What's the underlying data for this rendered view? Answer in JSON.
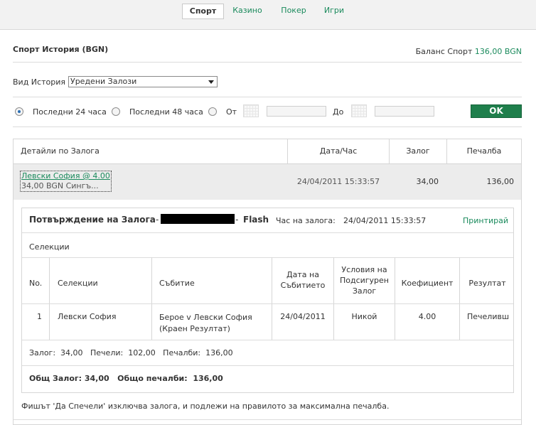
{
  "nav": {
    "tabs": [
      {
        "label": "Спорт",
        "active": true
      },
      {
        "label": "Казино",
        "active": false
      },
      {
        "label": "Покер",
        "active": false
      },
      {
        "label": "Игри",
        "active": false
      }
    ]
  },
  "header": {
    "title": "Спорт История (BGN)",
    "balance_label": "Баланс Спорт",
    "balance_value": "136,00 BGN"
  },
  "filter": {
    "history_label": "Вид История",
    "history_selected": "Уредени Залози",
    "opt_24h": "Последни 24 часа",
    "opt_48h": "Последни 48 часа",
    "from_label": "От",
    "to_label": "До",
    "ok_label": "OK",
    "selected_option": "24h"
  },
  "table": {
    "headers": [
      "Детайли по Залога",
      "Дата/Час",
      "Залог",
      "Печалба"
    ],
    "bet": {
      "link_text": "Левски София @ 4.00",
      "sub_text": "34,00 BGN  Сингъ...",
      "datetime": "24/04/2011 15:33:57",
      "stake": "34,00",
      "winnings": "136,00"
    }
  },
  "detail": {
    "title": "Потвърждение на Залога",
    "dash1": "-",
    "dash2": "-",
    "flash": "Flash",
    "time_label": "Час на залога:",
    "time_value": "24/04/2011 15:33:57",
    "print_label": "Принтирай",
    "selections_label": "Селекции",
    "columns": [
      "No.",
      "Селекции",
      "Събитие",
      "Дата на Събитието",
      "Условия на Подсигурен Залог",
      "Коефициент",
      "Резултат"
    ],
    "row": {
      "no": "1",
      "selection": "Левски София",
      "event_line1": "Берое v Левски София",
      "event_line2": "(Краен Резултат)",
      "date": "24/04/2011",
      "condition": "Никой",
      "odds": "4.00",
      "result": "Печеливш"
    },
    "summary": "Залог:  34,00   Печели:  102,00   Печалби:  136,00",
    "total_stake_label": "Общ Залог:",
    "total_stake_value": "34,00",
    "total_win_label": "Общо печалби:",
    "total_win_value": "136,00"
  },
  "footnote": "Фишът 'Да Спечели' изключва залога, и подлежи на правилото за максимална печалба.",
  "colors": {
    "accent": "#1a8a5c",
    "button": "#1f7f4c"
  }
}
